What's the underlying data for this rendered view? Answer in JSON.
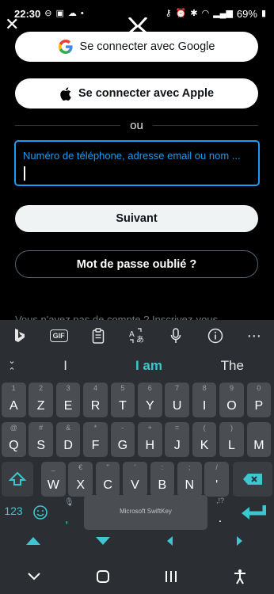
{
  "status": {
    "time": "22:30",
    "battery": "69%"
  },
  "login": {
    "google_label": "Se connecter avec Google",
    "apple_label": "Se connecter avec Apple",
    "divider": "ou",
    "input_placeholder": "Numéro de téléphone, adresse email ou nom ...",
    "next_label": "Suivant",
    "forgot_label": "Mot de passe oublié ?",
    "hidden_text": "Vous n'avez pas de compte ? Inscrivez-vous"
  },
  "keyboard": {
    "brand": "Microsoft SwiftKey",
    "toolbar": {
      "gif": "GIF"
    },
    "suggestions": [
      "I",
      "I am",
      "The"
    ],
    "row1": [
      {
        "k": "A",
        "h": "1"
      },
      {
        "k": "Z",
        "h": "2"
      },
      {
        "k": "E",
        "h": "3"
      },
      {
        "k": "R",
        "h": "4"
      },
      {
        "k": "T",
        "h": "5"
      },
      {
        "k": "Y",
        "h": "6"
      },
      {
        "k": "U",
        "h": "7"
      },
      {
        "k": "I",
        "h": "8"
      },
      {
        "k": "O",
        "h": "9"
      },
      {
        "k": "P",
        "h": "0"
      }
    ],
    "row2": [
      {
        "k": "Q",
        "h": "@"
      },
      {
        "k": "S",
        "h": "#"
      },
      {
        "k": "D",
        "h": "&"
      },
      {
        "k": "F",
        "h": "*"
      },
      {
        "k": "G",
        "h": "-"
      },
      {
        "k": "H",
        "h": "+"
      },
      {
        "k": "J",
        "h": "="
      },
      {
        "k": "K",
        "h": "("
      },
      {
        "k": "L",
        "h": ")"
      },
      {
        "k": "M",
        "h": ""
      }
    ],
    "row3": [
      {
        "k": "W",
        "h": "_"
      },
      {
        "k": "X",
        "h": "€"
      },
      {
        "k": "C",
        "h": "\""
      },
      {
        "k": "V",
        "h": "'"
      },
      {
        "k": "B",
        "h": ":"
      },
      {
        "k": "N",
        "h": ";"
      },
      {
        "k": "'",
        "h": "/"
      }
    ],
    "num_label": "123",
    "punct_hint": ",!?",
    "punct_main": "."
  }
}
